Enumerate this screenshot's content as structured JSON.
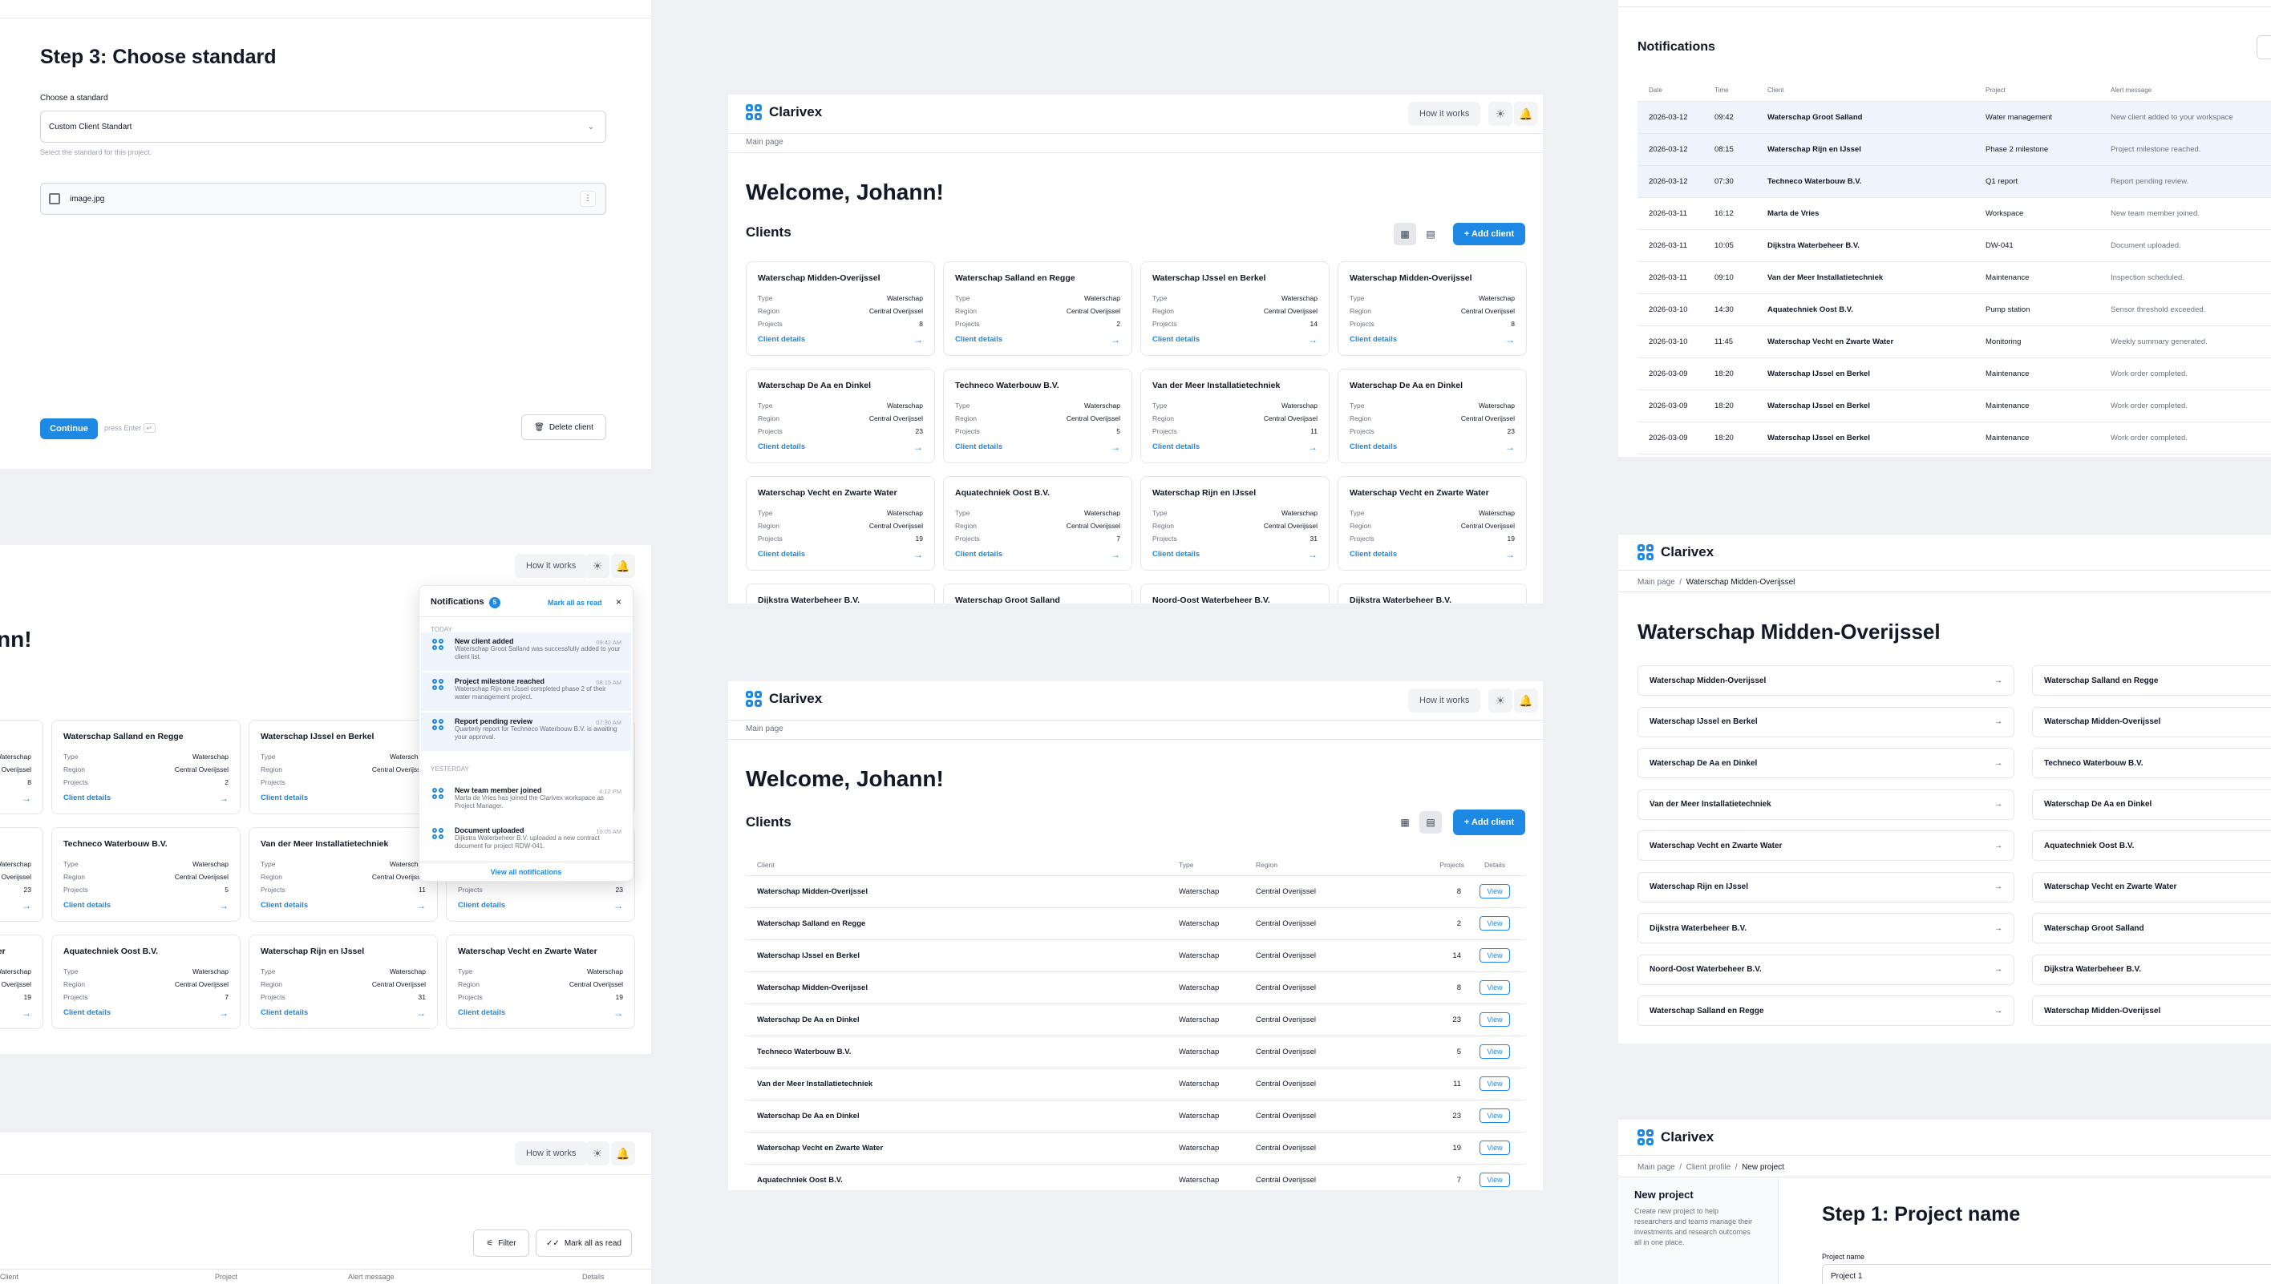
{
  "app": {
    "brand": "Clarivex",
    "how_it_works": "How it works",
    "main_page": "Main page",
    "welcome": "Welcome, Johann!",
    "clients": "Clients",
    "add_client": "+ Add client",
    "client_details": "Client details",
    "type_l": "Type",
    "region_l": "Region",
    "projects_l": "Projects"
  },
  "step3": {
    "title": "Step 3: Choose standard",
    "choose_label": "Choose a standard",
    "select_value": "Custom Client Standart",
    "helper": "Select the standard for this project.",
    "file": "image.jpg",
    "continue": "Continue",
    "press_enter": "press Enter",
    "delete": "Delete client"
  },
  "cards": [
    {
      "name": "Waterschap Midden-Overijssel",
      "type": "Waterschap",
      "region": "Central Overijssel",
      "projects": "8"
    },
    {
      "name": "Waterschap Salland en Regge",
      "type": "Waterschap",
      "region": "Central Overijssel",
      "projects": "2"
    },
    {
      "name": "Waterschap IJssel en Berkel",
      "type": "Waterschap",
      "region": "Central Overijssel",
      "projects": "14"
    },
    {
      "name": "Waterschap Midden-Overijssel",
      "type": "Waterschap",
      "region": "Central Overijssel",
      "projects": "8"
    },
    {
      "name": "Waterschap De Aa en Dinkel",
      "type": "Waterschap",
      "region": "Central Overijssel",
      "projects": "23"
    },
    {
      "name": "Techneco Waterbouw B.V.",
      "type": "Waterschap",
      "region": "Central Overijssel",
      "projects": "5"
    },
    {
      "name": "Van der Meer Installatietechniek",
      "type": "Waterschap",
      "region": "Central Overijssel",
      "projects": "11"
    },
    {
      "name": "Waterschap De Aa en Dinkel",
      "type": "Waterschap",
      "region": "Central Overijssel",
      "projects": "23"
    },
    {
      "name": "Waterschap Vecht en Zwarte Water",
      "type": "Waterschap",
      "region": "Central Overijssel",
      "projects": "19"
    },
    {
      "name": "Aquatechniek Oost B.V.",
      "type": "Waterschap",
      "region": "Central Overijssel",
      "projects": "7"
    },
    {
      "name": "Waterschap Rijn en IJssel",
      "type": "Waterschap",
      "region": "Central Overijssel",
      "projects": "31"
    },
    {
      "name": "Waterschap Vecht en Zwarte Water",
      "type": "Waterschap",
      "region": "Central Overijssel",
      "projects": "19"
    }
  ],
  "cards_row4": [
    "Dijkstra Waterbeheer B.V.",
    "Waterschap Groot Salland",
    "Noord-Oost Waterbeheer B.V.",
    "Dijkstra Waterbeheer B.V."
  ],
  "notif_table": {
    "title": "Notifications",
    "cols": [
      "Date",
      "Time",
      "Client",
      "Project",
      "Alert message"
    ],
    "rows": [
      [
        "2026-03-12",
        "09:42",
        "Waterschap Groot Salland",
        "Water management",
        "New client added to your workspace"
      ],
      [
        "2026-03-12",
        "08:15",
        "Waterschap Rijn en IJssel",
        "Phase 2 milestone",
        "Project milestone reached."
      ],
      [
        "2026-03-12",
        "07:30",
        "Techneco Waterbouw B.V.",
        "Q1 report",
        "Report pending review."
      ],
      [
        "2026-03-11",
        "16:12",
        "Marta de Vries",
        "Workspace",
        "New team member joined."
      ],
      [
        "2026-03-11",
        "10:05",
        "Dijkstra Waterbeheer B.V.",
        "DW-041",
        "Document uploaded."
      ],
      [
        "2026-03-11",
        "09:10",
        "Van der Meer Installatietechniek",
        "Maintenance",
        "Inspection scheduled."
      ],
      [
        "2026-03-10",
        "14:30",
        "Aquatechniek Oost B.V.",
        "Pump station",
        "Sensor threshold exceeded."
      ],
      [
        "2026-03-10",
        "11:45",
        "Waterschap Vecht en Zwarte Water",
        "Monitoring",
        "Weekly summary generated."
      ],
      [
        "2026-03-09",
        "18:20",
        "Waterschap IJssel en Berkel",
        "Maintenance",
        "Work order completed."
      ],
      [
        "2026-03-09",
        "18:20",
        "Waterschap IJssel en Berkel",
        "Maintenance",
        "Work order completed."
      ],
      [
        "2026-03-09",
        "18:20",
        "Waterschap IJssel en Berkel",
        "Maintenance",
        "Work order completed."
      ]
    ]
  },
  "client_table": {
    "cols": [
      "Client",
      "Type",
      "Region",
      "Projects",
      "Details"
    ],
    "view": "View",
    "rows": [
      [
        "Waterschap Midden-Overijssel",
        "Waterschap",
        "Central Overijssel",
        "8"
      ],
      [
        "Waterschap Salland en Regge",
        "Waterschap",
        "Central Overijssel",
        "2"
      ],
      [
        "Waterschap IJssel en Berkel",
        "Waterschap",
        "Central Overijssel",
        "14"
      ],
      [
        "Waterschap Midden-Overijssel",
        "Waterschap",
        "Central Overijssel",
        "8"
      ],
      [
        "Waterschap De Aa en Dinkel",
        "Waterschap",
        "Central Overijssel",
        "23"
      ],
      [
        "Techneco Waterbouw B.V.",
        "Waterschap",
        "Central Overijssel",
        "5"
      ],
      [
        "Van der Meer Installatietechniek",
        "Waterschap",
        "Central Overijssel",
        "11"
      ],
      [
        "Waterschap De Aa en Dinkel",
        "Waterschap",
        "Central Overijssel",
        "23"
      ],
      [
        "Waterschap Vecht en Zwarte Water",
        "Waterschap",
        "Central Overijssel",
        "19"
      ],
      [
        "Aquatechniek Oost B.V.",
        "Waterschap",
        "Central Overijssel",
        "7"
      ]
    ]
  },
  "detail": {
    "crumb_current": "Waterschap Midden-Overijssel",
    "title": "Waterschap Midden-Overijssel",
    "left": [
      "Waterschap Midden-Overijssel",
      "Waterschap IJssel en Berkel",
      "Waterschap De Aa en Dinkel",
      "Van der Meer Installatietechniek",
      "Waterschap Vecht en Zwarte Water",
      "Waterschap Rijn en IJssel",
      "Dijkstra Waterbeheer B.V.",
      "Noord-Oost Waterbeheer B.V.",
      "Waterschap Salland en Regge"
    ],
    "right": [
      "Waterschap Salland en Regge",
      "Waterschap Midden-Overijssel",
      "Techneco Waterbouw B.V.",
      "Waterschap De Aa en Dinkel",
      "Aquatechniek Oost B.V.",
      "Waterschap Vecht en Zwarte Water",
      "Waterschap Groot Salland",
      "Dijkstra Waterbeheer B.V.",
      "Waterschap Midden-Overijssel"
    ]
  },
  "popover": {
    "title": "Notifications",
    "count": "5",
    "mark_all": "Mark all as read",
    "today": "TODAY",
    "yesterday": "YESTERDAY",
    "view_all": "View all notifications",
    "items": [
      {
        "t": "New client added",
        "d": "Waterschap Groot Salland was successfully added to your client list.",
        "tm": "09:42 AM"
      },
      {
        "t": "Project milestone reached",
        "d": "Waterschap Rijn en IJssel completed phase 2 of their water management project.",
        "tm": "08:15 AM"
      },
      {
        "t": "Report pending review",
        "d": "Quarterly report for Techneco Waterbouw B.V. is awaiting your approval.",
        "tm": "07:30 AM"
      },
      {
        "t": "New team member joined",
        "d": "Marta de Vries has joined the Clarivex workspace as Project Manager.",
        "tm": "4:12 PM"
      },
      {
        "t": "Document uploaded",
        "d": "Dijkstra Waterbeheer B.V. uploaded a new contract document for project RDW-041.",
        "tm": "10:05 AM"
      }
    ]
  },
  "notif_small": {
    "filter": "Filter",
    "mark_all": "Mark all as read",
    "cols": [
      "Client",
      "Project",
      "Alert message",
      "Details"
    ]
  },
  "newproj": {
    "crumb1": "Client profile",
    "crumb2": "New project",
    "side_title": "New project",
    "side_desc": "Create new project to help researchers and teams manage their investments and research outcomes all in one place.",
    "title": "Step 1: Project name",
    "label": "Project name",
    "value": "Project 1"
  },
  "partial": {
    "welcome_tail": "nn!"
  }
}
